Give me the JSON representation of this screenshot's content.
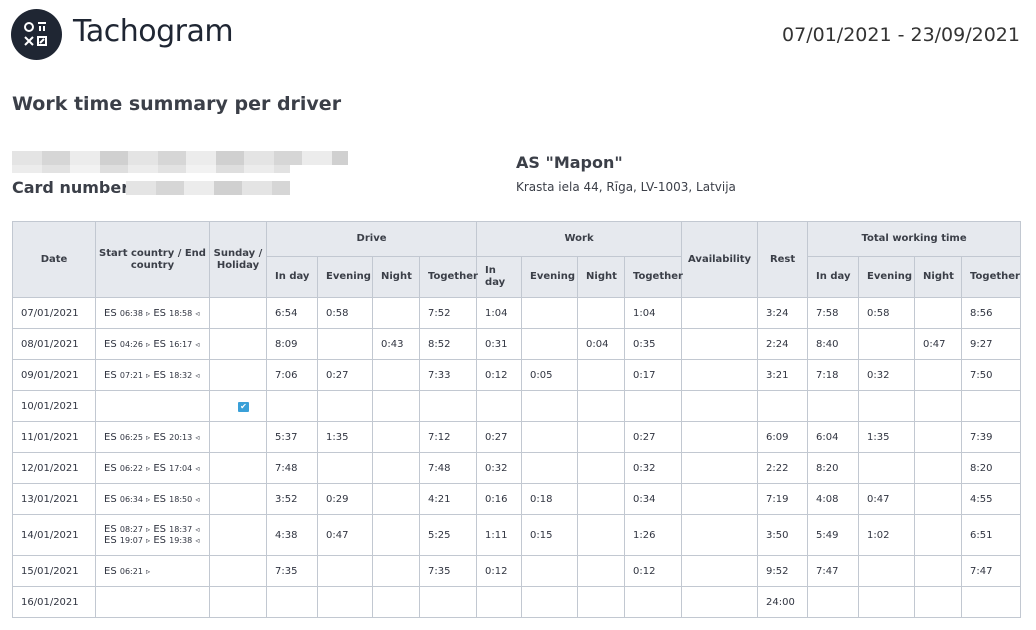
{
  "header": {
    "app_title": "Tachogram",
    "date_range": "07/01/2021 - 23/09/2021"
  },
  "page_title": "Work time summary per driver",
  "driver": {
    "card_label": "Card number:"
  },
  "company": {
    "name": "AS \"Mapon\"",
    "address": "Krasta iela 44, Rīga, LV-1003, Latvija"
  },
  "table": {
    "headers": {
      "date": "Date",
      "country": "Start country / End country",
      "sunday": "Sunday / Holiday",
      "drive": "Drive",
      "work": "Work",
      "availability": "Availability",
      "rest": "Rest",
      "total": "Total working time",
      "sub": {
        "in_day": "In day",
        "evening": "Evening",
        "night": "Night",
        "together": "Together"
      }
    },
    "rows": [
      {
        "date": "07/01/2021",
        "c1": "ES",
        "t1": "06:38",
        "c2": "ES",
        "t2": "18:58",
        "e2": "◃",
        "d_day": "6:54",
        "d_eve": "0:58",
        "d_night": "",
        "d_tog": "7:52",
        "w_day": "1:04",
        "w_eve": "",
        "w_night": "",
        "w_tog": "1:04",
        "avail": "",
        "rest": "3:24",
        "t_day": "7:58",
        "t_eve": "0:58",
        "t_night": "",
        "t_tog": "8:56"
      },
      {
        "date": "08/01/2021",
        "c1": "ES",
        "t1": "04:26",
        "c2": "ES",
        "t2": "16:17",
        "e2": "◃",
        "d_day": "8:09",
        "d_eve": "",
        "d_night": "0:43",
        "d_tog": "8:52",
        "w_day": "0:31",
        "w_eve": "",
        "w_night": "0:04",
        "w_tog": "0:35",
        "avail": "",
        "rest": "2:24",
        "t_day": "8:40",
        "t_eve": "",
        "t_night": "0:47",
        "t_tog": "9:27"
      },
      {
        "date": "09/01/2021",
        "c1": "ES",
        "t1": "07:21",
        "c2": "ES",
        "t2": "18:32",
        "e2": "◃",
        "d_day": "7:06",
        "d_eve": "0:27",
        "d_night": "",
        "d_tog": "7:33",
        "w_day": "0:12",
        "w_eve": "0:05",
        "w_night": "",
        "w_tog": "0:17",
        "avail": "",
        "rest": "3:21",
        "t_day": "7:18",
        "t_eve": "0:32",
        "t_night": "",
        "t_tog": "7:50"
      },
      {
        "date": "10/01/2021",
        "sunday_checked": true,
        "d_day": "",
        "d_eve": "",
        "d_night": "",
        "d_tog": "",
        "w_day": "",
        "w_eve": "",
        "w_night": "",
        "w_tog": "",
        "avail": "",
        "rest": "",
        "t_day": "",
        "t_eve": "",
        "t_night": "",
        "t_tog": ""
      },
      {
        "date": "11/01/2021",
        "c1": "ES",
        "t1": "06:25",
        "c2": "ES",
        "t2": "20:13",
        "e2": "◃",
        "d_day": "5:37",
        "d_eve": "1:35",
        "d_night": "",
        "d_tog": "7:12",
        "w_day": "0:27",
        "w_eve": "",
        "w_night": "",
        "w_tog": "0:27",
        "avail": "",
        "rest": "6:09",
        "t_day": "6:04",
        "t_eve": "1:35",
        "t_night": "",
        "t_tog": "7:39"
      },
      {
        "date": "12/01/2021",
        "c1": "ES",
        "t1": "06:22",
        "c2": "ES",
        "t2": "17:04",
        "e2": "◃",
        "d_day": "7:48",
        "d_eve": "",
        "d_night": "",
        "d_tog": "7:48",
        "w_day": "0:32",
        "w_eve": "",
        "w_night": "",
        "w_tog": "0:32",
        "avail": "",
        "rest": "2:22",
        "t_day": "8:20",
        "t_eve": "",
        "t_night": "",
        "t_tog": "8:20"
      },
      {
        "date": "13/01/2021",
        "c1": "ES",
        "t1": "06:34",
        "c2": "ES",
        "t2": "18:50",
        "e2": "◃",
        "d_day": "3:52",
        "d_eve": "0:29",
        "d_night": "",
        "d_tog": "4:21",
        "w_day": "0:16",
        "w_eve": "0:18",
        "w_night": "",
        "w_tog": "0:34",
        "avail": "",
        "rest": "7:19",
        "t_day": "4:08",
        "t_eve": "0:47",
        "t_night": "",
        "t_tog": "4:55"
      },
      {
        "date": "14/01/2021",
        "tall": true,
        "c1": "ES",
        "t1": "08:27",
        "c2": "ES",
        "t2": "18:37",
        "e2": "◃",
        "c3": "ES",
        "t3": "19:07",
        "c4": "ES",
        "t4": "19:38",
        "e4": "◃",
        "d_day": "4:38",
        "d_eve": "0:47",
        "d_night": "",
        "d_tog": "5:25",
        "w_day": "1:11",
        "w_eve": "0:15",
        "w_night": "",
        "w_tog": "1:26",
        "avail": "",
        "rest": "3:50",
        "t_day": "5:49",
        "t_eve": "1:02",
        "t_night": "",
        "t_tog": "6:51"
      },
      {
        "date": "15/01/2021",
        "c1": "ES",
        "t1": "06:21",
        "c2": "",
        "t2": "",
        "e2": "",
        "d_day": "7:35",
        "d_eve": "",
        "d_night": "",
        "d_tog": "7:35",
        "w_day": "0:12",
        "w_eve": "",
        "w_night": "",
        "w_tog": "0:12",
        "avail": "",
        "rest": "9:52",
        "t_day": "7:47",
        "t_eve": "",
        "t_night": "",
        "t_tog": "7:47"
      },
      {
        "date": "16/01/2021",
        "d_day": "",
        "d_eve": "",
        "d_night": "",
        "d_tog": "",
        "w_day": "",
        "w_eve": "",
        "w_night": "",
        "w_tog": "",
        "avail": "",
        "rest": "24:00",
        "t_day": "",
        "t_eve": "",
        "t_night": "",
        "t_tog": ""
      }
    ]
  }
}
